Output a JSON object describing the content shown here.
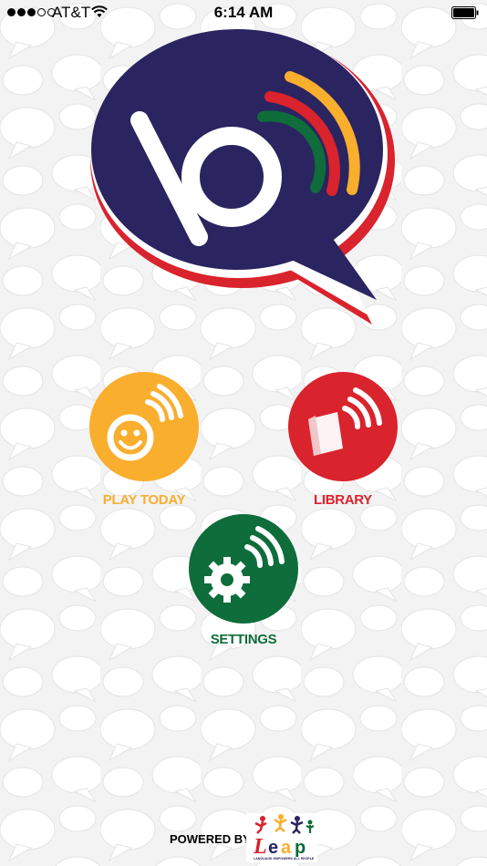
{
  "status_bar": {
    "signal_dots": [
      true,
      true,
      true,
      false,
      false
    ],
    "carrier": "AT&T",
    "time": "6:14 AM",
    "wifi_icon": "wifi-icon",
    "battery_icon": "battery-full-icon"
  },
  "logo": {
    "icon": "speech-bubble-b-logo-icon"
  },
  "menu": {
    "play_today": {
      "label": "PLAY TODAY",
      "icon": "smiley-sound-icon",
      "color": "#f9ae2e"
    },
    "library": {
      "label": "LIBRARY",
      "icon": "book-sound-icon",
      "color": "#d9232d"
    },
    "settings": {
      "label": "SETTINGS",
      "icon": "gear-sound-icon",
      "color": "#0e6d3a"
    }
  },
  "footer": {
    "powered_by": "POWERED BY",
    "brand_icon": "leap-logo",
    "brand_word": "Leap",
    "brand_tagline": "LANGUAGE EMPOWERS ALL PEOPLE"
  },
  "colors": {
    "navy": "#2a2460",
    "red": "#d9232d",
    "orange": "#f9ae2e",
    "green": "#0e6d3a",
    "background": "#f4f4f4"
  }
}
